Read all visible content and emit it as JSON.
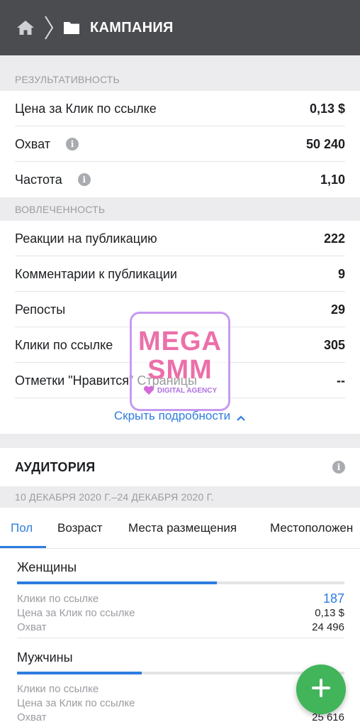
{
  "header": {
    "title": "КАМПАНИЯ",
    "icons": [
      "home-icon",
      "chevron-right-icon",
      "folder-icon"
    ]
  },
  "performance": {
    "section_title": "РЕЗУЛЬТАТИВНОСТЬ",
    "rows": [
      {
        "label": "Цена за Клик по ссылке",
        "value": "0,13 $",
        "info": false
      },
      {
        "label": "Охват",
        "value": "50 240",
        "info": true
      },
      {
        "label": "Частота",
        "value": "1,10",
        "info": true
      }
    ]
  },
  "engagement": {
    "section_title": "ВОВЛЕЧЕННОСТЬ",
    "rows": [
      {
        "label": "Реакции на публикацию",
        "value": "222"
      },
      {
        "label": "Комментарии к публикации",
        "value": "9"
      },
      {
        "label": "Репосты",
        "value": "29"
      },
      {
        "label": "Клики по ссылке",
        "value": "305"
      },
      {
        "label": "Отметки \"Нравится\" Страницы",
        "value": "--"
      }
    ]
  },
  "hide_details": {
    "label": "Скрыть подробности"
  },
  "audience": {
    "title": "АУДИТОРИЯ",
    "date_range": "10 ДЕКАБРЯ 2020 Г.–24 ДЕКАБРЯ 2020 Г.",
    "tabs": [
      {
        "label": "Пол",
        "active": true
      },
      {
        "label": "Возраст",
        "active": false
      },
      {
        "label": "Места размещения",
        "active": false
      },
      {
        "label": "Местоположен",
        "active": false
      }
    ],
    "groups": [
      {
        "name": "Женщины",
        "share": 0.61,
        "metrics": [
          {
            "label": "Клики по ссылке",
            "value": "187",
            "highlight": true
          },
          {
            "label": "Цена за Клик по ссылке",
            "value": "0,13 $",
            "highlight": false
          },
          {
            "label": "Охват",
            "value": "24 496",
            "highlight": false
          }
        ]
      },
      {
        "name": "Мужчины",
        "share": 0.38,
        "metrics": [
          {
            "label": "Клики по ссылке",
            "value": "",
            "highlight": true
          },
          {
            "label": "Цена за Клик по ссылке",
            "value": "",
            "highlight": false
          },
          {
            "label": "Охват",
            "value": "25 616",
            "highlight": false
          }
        ]
      }
    ]
  },
  "watermark": {
    "line1": "MEGA",
    "line2": "SMM",
    "line3": "DIGITAL AGENCY"
  },
  "fab": {
    "icon": "plus-icon"
  },
  "colors": {
    "header_bg": "#4b4c4f",
    "accent": "#2d7de0",
    "fab": "#42b55a",
    "section_bg": "#ececee"
  }
}
